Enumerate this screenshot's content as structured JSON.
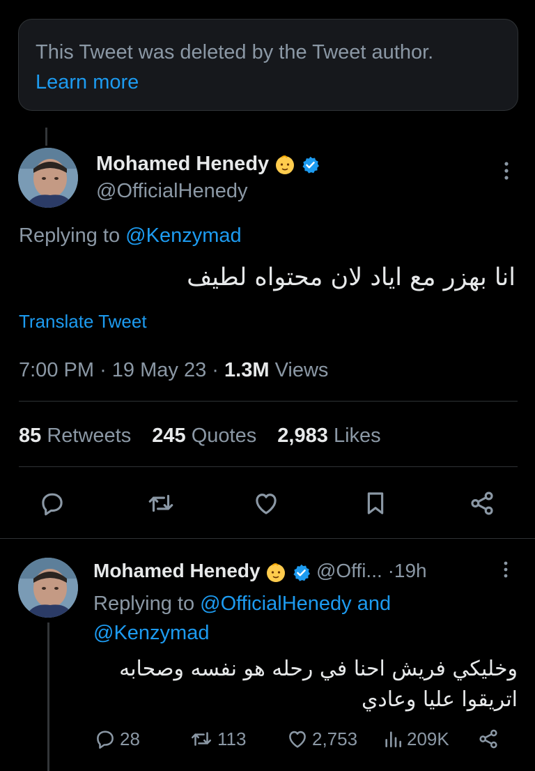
{
  "deleted_notice": {
    "text": "This Tweet was deleted by the Tweet author.",
    "link": "Learn more"
  },
  "main_tweet": {
    "author_name": "Mohamed Henedy",
    "author_handle": "@OfficialHenedy",
    "replying_prefix": "Replying to",
    "replying_to": "@Kenzymad",
    "text": "انا بهزر مع اياد لان محتواه لطيف",
    "translate": "Translate Tweet",
    "time": "7:00 PM",
    "date": "19 May 23",
    "views_count": "1.3M",
    "views_label": "Views",
    "retweets_count": "85",
    "retweets_label": "Retweets",
    "quotes_count": "245",
    "quotes_label": "Quotes",
    "likes_count": "2,983",
    "likes_label": "Likes"
  },
  "reply_tweet": {
    "author_name": "Mohamed Henedy",
    "author_handle": "@Offi...",
    "time_ago": "19h",
    "replying_prefix": "Replying to",
    "replying_to_1": "@OfficialHenedy",
    "replying_and": "and",
    "replying_to_2": "@Kenzymad",
    "text_line1": "وخليكي فريش احنا في رحله هو نفسه وصحابه",
    "text_line2": "اتريقوا عليا وعادي",
    "replies": "28",
    "retweets": "113",
    "likes": "2,753",
    "views": "209K"
  },
  "icons": {
    "emoji": "baby-face-icon",
    "verified": "verified-badge-icon",
    "more": "more-vertical-icon",
    "reply": "reply-icon",
    "retweet": "retweet-icon",
    "like": "heart-icon",
    "bookmark": "bookmark-icon",
    "share": "share-icon",
    "views": "views-chart-icon"
  },
  "colors": {
    "background": "#000000",
    "card": "#16181c",
    "accent": "#1d9bf0",
    "muted": "#8b98a5",
    "text": "#e7e9ea",
    "divider": "#2f3336"
  }
}
